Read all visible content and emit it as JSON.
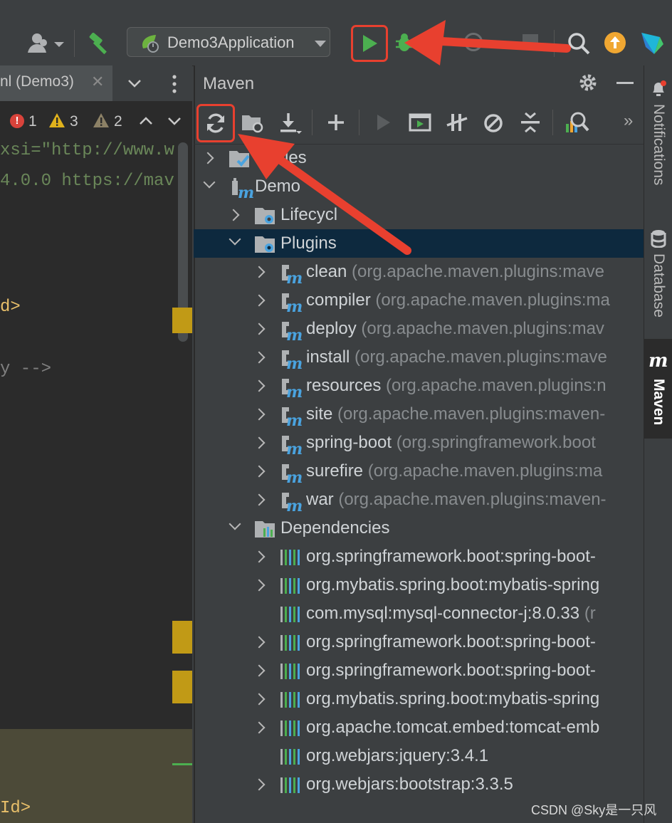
{
  "toolbar": {
    "run_config_label": "Demo3Application",
    "icons": [
      "user-icon",
      "hammer-icon",
      "spring-icon",
      "run-icon",
      "debug-icon",
      "search-icon",
      "update-icon",
      "toolbox-icon"
    ],
    "accent_run": "#4caf50",
    "accent_highlight": "#e8402f"
  },
  "editor": {
    "tab_label": "nl (Demo3)",
    "inspections": {
      "errors": "1",
      "warnings": "3",
      "weak_warnings": "2"
    },
    "code_lines": [
      {
        "text": "xsi=\"http://www.w",
        "color": "#6a8759"
      },
      {
        "text": "4.0.0 https://mav",
        "color": "#6a8759"
      },
      {
        "text": "d>",
        "color": "#e8bf6a"
      },
      {
        "text": "y -->",
        "color": "#808080"
      },
      {
        "text": "Id>",
        "color": "#e8bf6a"
      }
    ]
  },
  "maven": {
    "title": "Maven",
    "toolbar_icons": [
      "reload-icon",
      "generate-sources-icon",
      "download-icon",
      "add-icon",
      "run-icon",
      "execute-goal-icon",
      "toggle-offline-icon",
      "skip-tests-icon",
      "collapse-all-icon",
      "analyze-dependencies-icon",
      "more-icon"
    ],
    "more_label": "»",
    "tree": {
      "profiles_label": "files",
      "project_label": "Demo",
      "lifecycle_label": "Lifecycl",
      "plugins_label": "Plugins",
      "plugins": [
        {
          "name": "clean",
          "coords": "(org.apache.maven.plugins:mave"
        },
        {
          "name": "compiler",
          "coords": "(org.apache.maven.plugins:ma"
        },
        {
          "name": "deploy",
          "coords": "(org.apache.maven.plugins:mav"
        },
        {
          "name": "install",
          "coords": "(org.apache.maven.plugins:mave"
        },
        {
          "name": "resources",
          "coords": "(org.apache.maven.plugins:n"
        },
        {
          "name": "site",
          "coords": "(org.apache.maven.plugins:maven-"
        },
        {
          "name": "spring-boot",
          "coords": "(org.springframework.boot"
        },
        {
          "name": "surefire",
          "coords": "(org.apache.maven.plugins:ma"
        },
        {
          "name": "war",
          "coords": "(org.apache.maven.plugins:maven-"
        }
      ],
      "dependencies_label": "Dependencies",
      "dependencies": [
        {
          "name": "org.springframework.boot:spring-boot-",
          "extra": "",
          "expandable": true
        },
        {
          "name": "org.mybatis.spring.boot:mybatis-spring",
          "extra": "",
          "expandable": true
        },
        {
          "name": "com.mysql:mysql-connector-j:8.0.33",
          "extra": "(r",
          "expandable": false
        },
        {
          "name": "org.springframework.boot:spring-boot-",
          "extra": "",
          "expandable": true
        },
        {
          "name": "org.springframework.boot:spring-boot-",
          "extra": "",
          "expandable": true
        },
        {
          "name": "org.mybatis.spring.boot:mybatis-spring",
          "extra": "",
          "expandable": true
        },
        {
          "name": "org.apache.tomcat.embed:tomcat-emb",
          "extra": "",
          "expandable": true
        },
        {
          "name": "org.webjars:jquery:3.4.1",
          "extra": "",
          "expandable": false
        },
        {
          "name": "org.webjars:bootstrap:3.3.5",
          "extra": "",
          "expandable": true
        }
      ]
    }
  },
  "side_stripe": {
    "notifications_label": "Notifications",
    "database_label": "Database",
    "maven_label": "Maven"
  },
  "watermark": "CSDN @Sky是一只风"
}
